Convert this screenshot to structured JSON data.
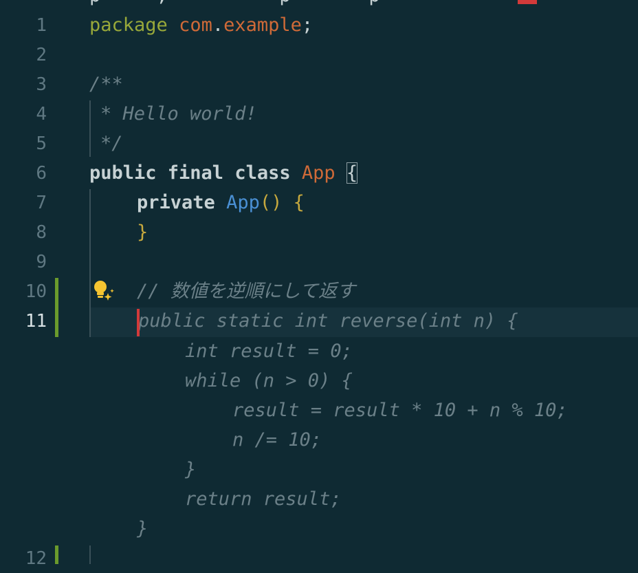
{
  "editor": {
    "top_peek": "p     ,          p       p   ",
    "lines": [
      {
        "number": "1"
      },
      {
        "number": "2"
      },
      {
        "number": "3"
      },
      {
        "number": "4"
      },
      {
        "number": "5"
      },
      {
        "number": "6"
      },
      {
        "number": "7"
      },
      {
        "number": "8"
      },
      {
        "number": "9"
      },
      {
        "number": "10"
      },
      {
        "number": "11"
      },
      {
        "number": "12"
      }
    ],
    "code": {
      "l1_kw": "package",
      "l1_pkg1": "com",
      "l1_dot": ".",
      "l1_pkg2": "example",
      "l1_semi": ";",
      "l3": "/**",
      "l4": "* Hello world!",
      "l5": "*/",
      "l6_kw": "public final class",
      "l6_cls": "App",
      "l6_brace": "{",
      "l7_kw": "private",
      "l7_ctor": "App",
      "l7_parens": "()",
      "l7_brace": "{",
      "l8_brace": "}",
      "l10_comment": "// 数値を逆順にして返す"
    },
    "suggestion": {
      "line1": "public static int reverse(int n) {",
      "line2": "int result = 0;",
      "line3": "while (n > 0) {",
      "line4": "result = result * 10 + n % 10;",
      "line5": "n /= 10;",
      "line6": "}",
      "line7": "return result;",
      "line8": "}"
    },
    "active_line": "11",
    "colors": {
      "background": "#0f2a33",
      "keyword": "#c7d2d4",
      "package_keyword": "#98a83a",
      "class_name": "#cf6a38",
      "constructor": "#4a90d4",
      "punctuation": "#c7a93e",
      "comment": "#6b8088",
      "git_added": "#6a9a2c",
      "caret": "#d23a3a"
    }
  }
}
